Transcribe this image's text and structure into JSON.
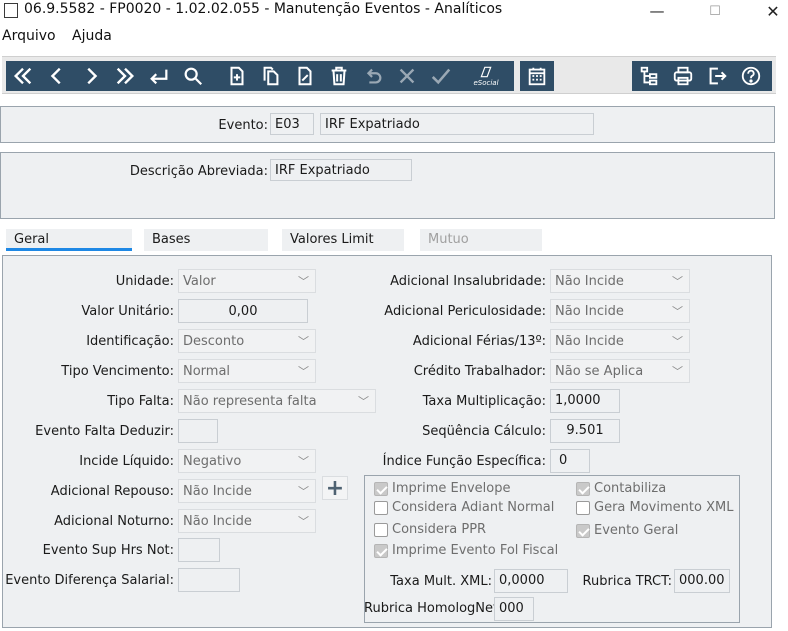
{
  "window": {
    "title": "06.9.5582 - FP0020 - 1.02.02.055 - Manutenção Eventos - Analíticos",
    "minimize": "—",
    "maximize": "☐",
    "close": "✕"
  },
  "menu": {
    "items": [
      "Arquivo",
      "Ajuda"
    ]
  },
  "toolbar": {
    "esocial_label": "eSocial",
    "buttons": [
      "first",
      "previous",
      "next",
      "last",
      "return",
      "search",
      "new",
      "copy",
      "edit",
      "delete",
      "undo",
      "cancel",
      "confirm",
      "esocial",
      "calendar",
      "tree",
      "print",
      "exit",
      "help"
    ]
  },
  "header": {
    "evento_label": "Evento:",
    "evento_code": "E03",
    "evento_name": "IRF Expatriado",
    "descricao_label": "Descrição Abreviada:",
    "descricao_value": "IRF Expatriado"
  },
  "tabs": [
    {
      "label": "Geral",
      "active": true
    },
    {
      "label": "Bases",
      "active": false
    },
    {
      "label": "Valores Limit",
      "active": false
    },
    {
      "label": "Mutuo",
      "active": false,
      "disabled": true
    }
  ],
  "left": {
    "unidade": {
      "label": "Unidade:",
      "value": "Valor"
    },
    "valor_unitario": {
      "label": "Valor Unitário:",
      "value": "0,00"
    },
    "identificacao": {
      "label": "Identificação:",
      "value": "Desconto"
    },
    "tipo_vencimento": {
      "label": "Tipo Vencimento:",
      "value": "Normal"
    },
    "tipo_falta": {
      "label": "Tipo Falta:",
      "value": "Não representa falta"
    },
    "evento_falta_deduzir": {
      "label": "Evento Falta Deduzir:",
      "value": ""
    },
    "incide_liquido": {
      "label": "Incide Líquido:",
      "value": "Negativo"
    },
    "adicional_repouso": {
      "label": "Adicional Repouso:",
      "value": "Não Incide"
    },
    "adicional_noturno": {
      "label": "Adicional Noturno:",
      "value": "Não Incide"
    },
    "evento_sup_hrs_not": {
      "label": "Evento Sup Hrs Not:",
      "value": ""
    },
    "evento_diferenca_salarial": {
      "label": "Evento Diferença Salarial:",
      "value": ""
    },
    "plus_label": "+"
  },
  "right": {
    "adicional_insalubridade": {
      "label": "Adicional Insalubridade:",
      "value": "Não Incide"
    },
    "adicional_periculosidade": {
      "label": "Adicional Periculosidade:",
      "value": "Não Incide"
    },
    "adicional_ferias": {
      "label": "Adicional Férias/13º:",
      "value": "Não Incide"
    },
    "credito_trabalhador": {
      "label": "Crédito Trabalhador:",
      "value": "Não se Aplica"
    },
    "taxa_multiplicacao": {
      "label": "Taxa Multiplicação:",
      "value": "1,0000"
    },
    "sequencia_calculo": {
      "label": "Seqüência Cálculo:",
      "value": "9.501"
    },
    "indice_funcao": {
      "label": "Índice Função Específica:",
      "value": "0"
    }
  },
  "checks": {
    "imprime_envelope": {
      "label": "Imprime Envelope",
      "checked": true
    },
    "contabiliza": {
      "label": "Contabiliza",
      "checked": true
    },
    "considera_adiant": {
      "label": "Considera Adiant Normal",
      "checked": false
    },
    "gera_movimento": {
      "label": "Gera Movimento XML",
      "checked": false
    },
    "considera_ppr": {
      "label": "Considera PPR",
      "checked": false
    },
    "evento_geral": {
      "label": "Evento Geral",
      "checked": true
    },
    "imprime_evento_fol": {
      "label": "Imprime Evento Fol Fiscal",
      "checked": true
    }
  },
  "group": {
    "taxa_mult_xml": {
      "label": "Taxa Mult. XML:",
      "value": "0,0000"
    },
    "rubrica_trct": {
      "label": "Rubrica TRCT:",
      "value": "000.00"
    },
    "rubrica_homolognet": {
      "label": "Rubrica HomologNet:",
      "value": "000"
    }
  }
}
